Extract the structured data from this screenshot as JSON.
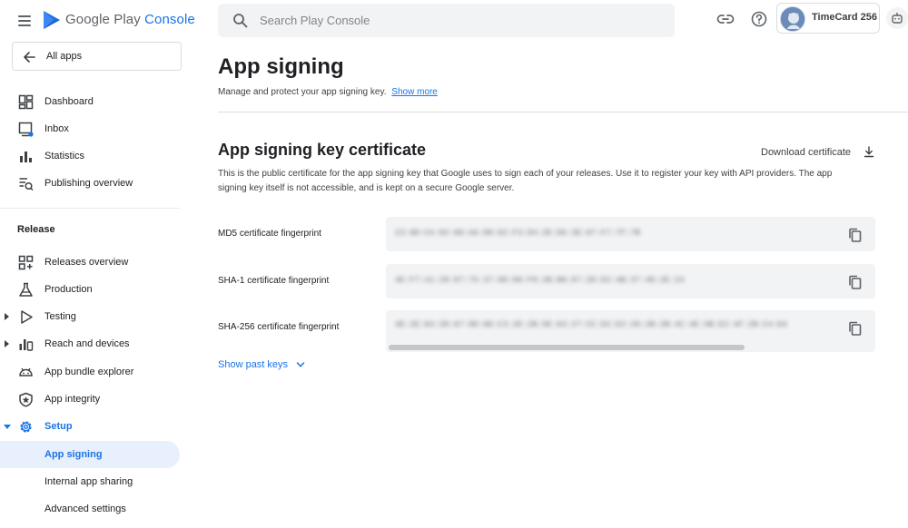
{
  "app": {
    "brand": "Google Play",
    "product": "Console"
  },
  "sidebar": {
    "back_label": "All apps",
    "items": [
      {
        "label": "Dashboard",
        "icon": "dashboard-icon"
      },
      {
        "label": "Inbox",
        "icon": "inbox-icon"
      },
      {
        "label": "Statistics",
        "icon": "bar-chart-icon"
      },
      {
        "label": "Publishing overview",
        "icon": "publishing-icon"
      }
    ],
    "release_section_title": "Release",
    "release_items": [
      {
        "label": "Releases overview",
        "icon": "releases-icon"
      },
      {
        "label": "Production",
        "icon": "flask-icon"
      },
      {
        "label": "Testing",
        "icon": "play-icon"
      },
      {
        "label": "Reach and devices",
        "icon": "reach-icon"
      },
      {
        "label": "App bundle explorer",
        "icon": "android-icon"
      },
      {
        "label": "App integrity",
        "icon": "shield-icon"
      },
      {
        "label": "Setup",
        "icon": "gear-icon"
      },
      {
        "label": "App signing",
        "icon": ""
      },
      {
        "label": "Internal app sharing",
        "icon": ""
      },
      {
        "label": "Advanced settings",
        "icon": ""
      }
    ]
  },
  "header": {
    "search_placeholder": "Search Play Console",
    "account_name": "TimeCard 256"
  },
  "main": {
    "title": "App signing",
    "subtitle": "Manage and protect your app signing key.",
    "show_more": "Show more",
    "cert_heading": "App signing key certificate",
    "download_label": "Download certificate",
    "description": "This is the public certificate for the app signing key that Google uses to sign each of your releases. Use it to register your key with API providers. The app signing key itself is not accessible, and is kept on a secure Google server.",
    "fingerprints": [
      {
        "label": "MD5 certificate fingerprint",
        "value": "23:0D:CA:02:0D:A6:D0:D2:F3:D4:2E:D6:3E:07:F7:7F:7B"
      },
      {
        "label": "SHA-1 certificate fingerprint",
        "value": "4E:F7:41:28:07:75:37:0D:D0:F8:2B:B8:87:2D:D2:4B:37:4D:2E:24"
      },
      {
        "label": "SHA-256 certificate fingerprint",
        "value": "4E:2E:03:2D:07:0D:0D:C3:2E:2B:5E:03:27:CC:D2:D2:2D:2B:2B:4C:4E:5B:E2:4F:2B:C4:D4"
      }
    ],
    "show_past_keys": "Show past keys"
  },
  "colors": {
    "accent": "#1a73e8",
    "active_bg": "#e8f0fe",
    "field_bg": "#f1f3f4"
  }
}
